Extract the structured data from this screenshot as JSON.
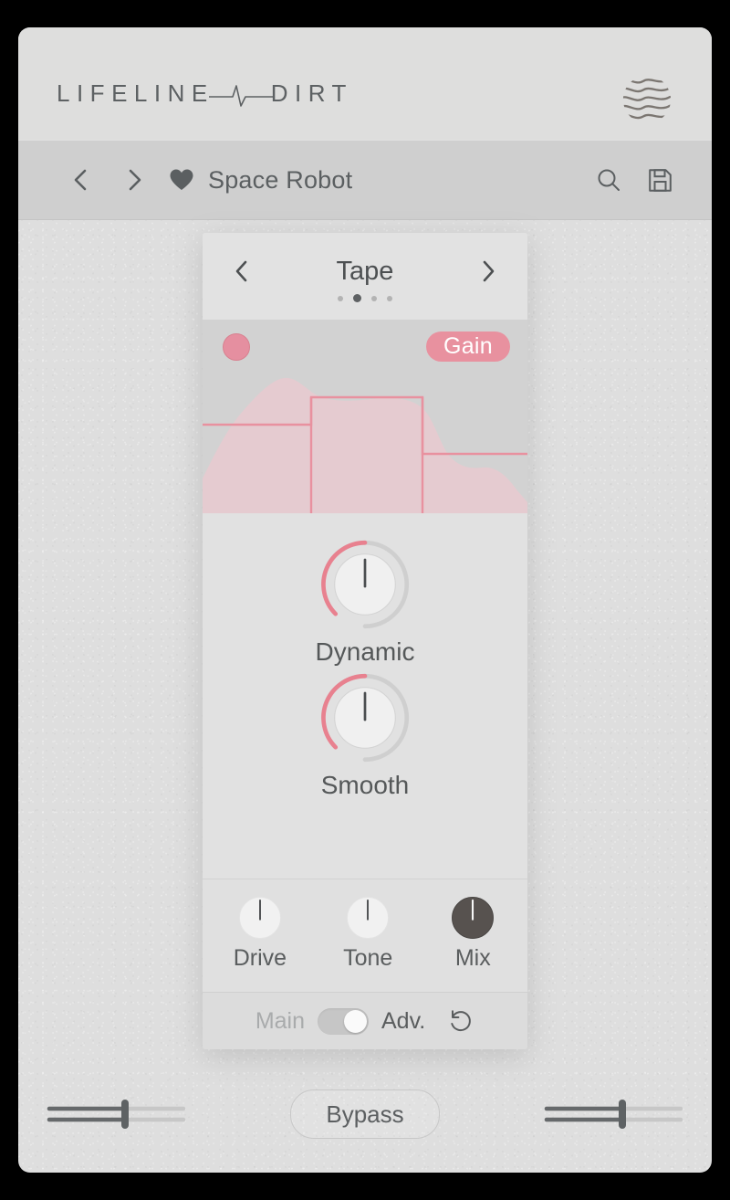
{
  "window": {
    "background_color": "#dedede",
    "frame_color": "#000000"
  },
  "brand": {
    "word_left": "LIFELINE",
    "word_right": "DIRT",
    "pulse_icon": "heartbeat-icon",
    "mark_icon": "wave-circle-icon",
    "text_color": "#5d6163"
  },
  "preset_bar": {
    "prev_icon": "chevron-left-icon",
    "next_icon": "chevron-right-icon",
    "favorite_icon": "heart-filled-icon",
    "preset_name": "Space Robot",
    "search_icon": "search-icon",
    "save_icon": "save-icon",
    "background_color": "#cfcfcf"
  },
  "module": {
    "prev_icon": "chevron-left-icon",
    "next_icon": "chevron-right-icon",
    "title": "Tape",
    "pages": 4,
    "active_page": 2,
    "visualization": {
      "dot_icon": "state-dot-icon",
      "badge_label": "Gain",
      "accent_color": "#e8919f",
      "fill_color": "#e9c9cf",
      "background_color": "#d2d2d2"
    },
    "main_knobs": [
      {
        "label": "Dynamic",
        "value_pct": 50,
        "style": "light"
      },
      {
        "label": "Smooth",
        "value_pct": 50,
        "style": "light"
      }
    ],
    "sub_knobs": [
      {
        "label": "Drive",
        "value_pct": 50,
        "style": "light"
      },
      {
        "label": "Tone",
        "value_pct": 50,
        "style": "light"
      },
      {
        "label": "Mix",
        "value_pct": 50,
        "style": "dark"
      }
    ],
    "footer": {
      "left_label": "Main",
      "right_label": "Adv.",
      "toggle_state": "Adv.",
      "reset_icon": "reset-icon"
    }
  },
  "bottom_bar": {
    "input_meter": {
      "name": "input-level-slider",
      "value_pct": 60
    },
    "bypass_label": "Bypass",
    "output_meter": {
      "name": "output-level-slider",
      "value_pct": 60
    }
  },
  "chart_data": {
    "type": "area",
    "title": "Gain transfer / signal envelope",
    "series": [
      {
        "name": "gain-step-curve",
        "type": "line",
        "color": "#e8919f",
        "points": [
          [
            0,
            0.47
          ],
          [
            0.33,
            0.47
          ],
          [
            0.33,
            0.33
          ],
          [
            0.67,
            0.33
          ],
          [
            0.67,
            0.61
          ],
          [
            1.0,
            0.61
          ]
        ]
      },
      {
        "name": "signal-envelope",
        "type": "area",
        "color": "#e9c9cf",
        "points": [
          [
            0.0,
            0.18
          ],
          [
            0.05,
            0.42
          ],
          [
            0.12,
            0.68
          ],
          [
            0.2,
            0.86
          ],
          [
            0.25,
            0.94
          ],
          [
            0.3,
            0.88
          ],
          [
            0.36,
            0.72
          ],
          [
            0.45,
            0.7
          ],
          [
            0.55,
            0.72
          ],
          [
            0.62,
            0.7
          ],
          [
            0.68,
            0.62
          ],
          [
            0.74,
            0.36
          ],
          [
            0.82,
            0.28
          ],
          [
            0.9,
            0.3
          ],
          [
            0.97,
            0.16
          ],
          [
            1.0,
            0.1
          ]
        ]
      }
    ],
    "xlabel": "",
    "ylabel": "",
    "grid": false,
    "legend": "none"
  }
}
